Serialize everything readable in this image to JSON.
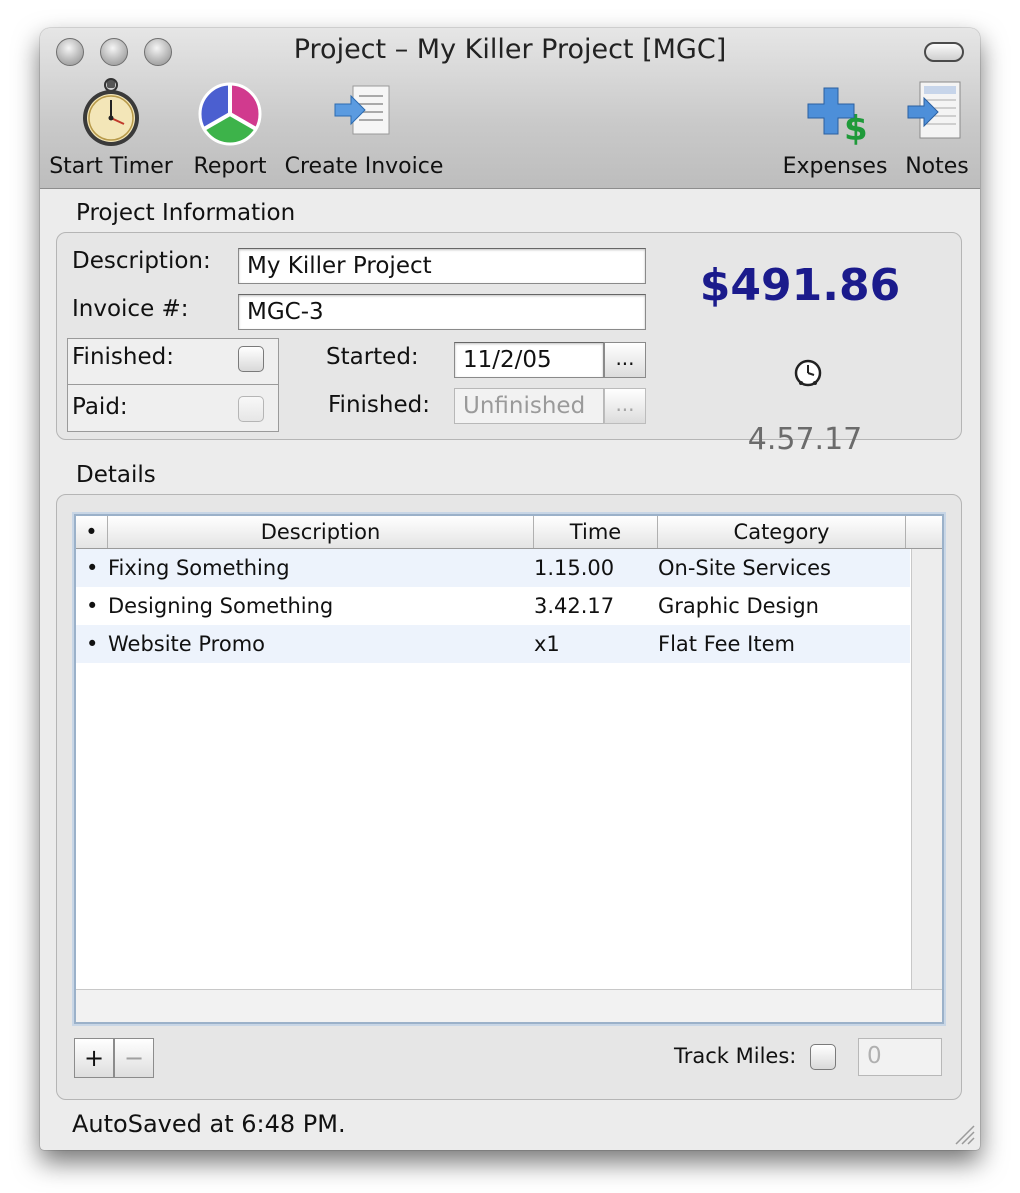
{
  "window": {
    "title": "Project – My Killer Project [MGC]"
  },
  "toolbar": {
    "start_timer": "Start Timer",
    "report": "Report",
    "create_invoice": "Create Invoice",
    "expenses": "Expenses",
    "notes": "Notes"
  },
  "project_info": {
    "section_label": "Project Information",
    "description_label": "Description:",
    "description_value": "My Killer Project",
    "invoice_label": "Invoice #:",
    "invoice_value": "MGC-3",
    "finished_label": "Finished:",
    "paid_label": "Paid:",
    "started_label": "Started:",
    "started_value": "11/2/05",
    "finished_date_label": "Finished:",
    "finished_date_value": "Unfinished",
    "date_button": "...",
    "amount": "$491.86",
    "timer_value": "4.57.17",
    "finished_checked": false,
    "paid_checked": false
  },
  "details": {
    "section_label": "Details",
    "columns": [
      "•",
      "Description",
      "Time",
      "Category"
    ],
    "rows": [
      {
        "bullet": "•",
        "description": "Fixing Something",
        "time": "1.15.00",
        "category": "On-Site Services"
      },
      {
        "bullet": "•",
        "description": "Designing Something",
        "time": "3.42.17",
        "category": "Graphic Design"
      },
      {
        "bullet": "•",
        "description": "Website Promo",
        "time": "x1",
        "category": "Flat Fee Item"
      }
    ],
    "add_button": "+",
    "remove_button": "−",
    "track_miles_label": "Track Miles:",
    "track_miles_checked": false,
    "miles_placeholder": "0"
  },
  "status": {
    "text": "AutoSaved at 6:48 PM."
  },
  "colors": {
    "amount": "#1b1b8c",
    "row_alt": "#edf3fc"
  }
}
